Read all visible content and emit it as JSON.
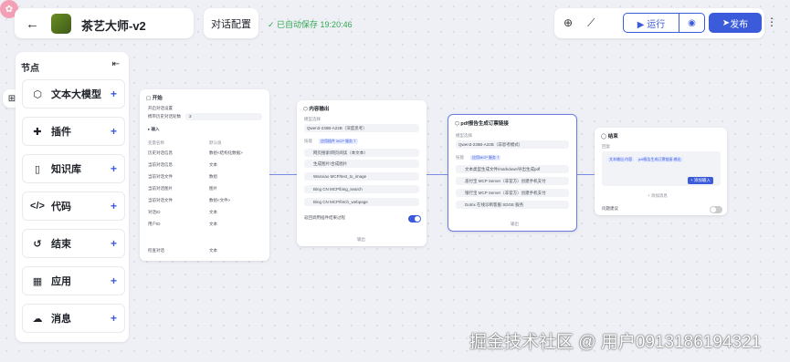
{
  "header": {
    "back_icon": "arrow-left-icon",
    "title": "茶艺大师-v2",
    "config_label": "对话配置",
    "saved_status": "已自动保存 19:20:46",
    "run_label": "运行",
    "publish_label": "发布"
  },
  "sidebar": {
    "title": "节点",
    "items": [
      {
        "label": "文本大模型",
        "icon": "cube-icon"
      },
      {
        "label": "插件",
        "icon": "puzzle-icon"
      },
      {
        "label": "知识库",
        "icon": "book-icon"
      },
      {
        "label": "代码",
        "icon": "code-icon"
      },
      {
        "label": "结束",
        "icon": "end-icon"
      },
      {
        "label": "应用",
        "icon": "grid-icon"
      },
      {
        "label": "消息",
        "icon": "message-icon"
      }
    ]
  },
  "nodes": {
    "start": {
      "title": "开始",
      "sub": "开启对话设置",
      "hist_label": "携带历史对话轮数",
      "hist_value": "3",
      "input_label": "输入",
      "col_var": "变量名称",
      "col_type": "默认值",
      "rows": [
        {
          "k": "历史对话信息",
          "v": "数组<结构化数据>"
        },
        {
          "k": "当前对话信息",
          "v": "文本"
        },
        {
          "k": "当前对话文件",
          "v": "数组"
        },
        {
          "k": "当前对话图片",
          "v": "图片"
        },
        {
          "k": "当前对话文件",
          "v": "数组<文件>"
        },
        {
          "k": "对话ID",
          "v": "文本"
        },
        {
          "k": "用户ID",
          "v": "文本"
        },
        {
          "k": "检查对话",
          "v": "文本"
        }
      ]
    },
    "llm": {
      "title": "内容输出",
      "model_label": "模型选择",
      "model": "Qwen3-235B-A22B（深度思考）",
      "tools_label": "技能",
      "tools_chip": "应用插件 MCP 服务 T",
      "tools": [
        "网页搜索/网页阅读（本文本）",
        "生成图片/合成图片",
        "Wanxiao MCP/text_to_image",
        "Bing CN MCP/bing_search",
        "Bing CN MCP/fetch_webpage"
      ],
      "toggle_label": "返回调用插件结果过程",
      "output_label": "输出"
    },
    "mcp": {
      "title": "pdf报告生成订票链接",
      "model_label": "模型选择",
      "model": "Qwen3-235B-A22B（非思考模式）",
      "tools_label": "技能",
      "tools_chip": "应用MCP 服务 T",
      "tools": [
        "文本类型生成文件/markdown导出生成pdf",
        "盖付宝 MCP Server（非官方）创建手机支付",
        "银行宝 MCP Server（非官方）创建手机支付",
        "Dotrix 在线诊断客服 SDGE 服务"
      ],
      "output_label": "输出"
    },
    "end": {
      "title": "结束",
      "output_label": "回复",
      "chip1": "文本输出.内容",
      "chip2": "pdf报告生成订票链接.输出",
      "add_var": "添加变量",
      "insert_btn": "+ 添加输入",
      "add_msg": "+ 添加消息",
      "stream_label": "问题建议"
    }
  },
  "watermark": "掘金技术社区 @ 用户0913186194321",
  "colors": {
    "accent": "#3b5bdb",
    "saved": "#34a853"
  }
}
